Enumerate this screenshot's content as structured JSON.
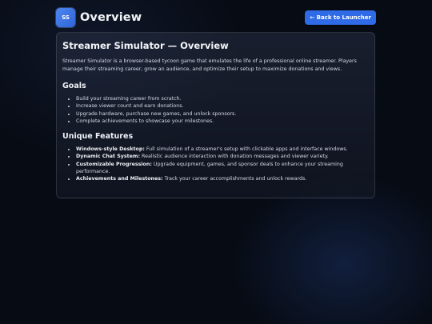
{
  "header": {
    "logo_text": "SS",
    "title": "Overview",
    "back_button_label": "← Back to Launcher"
  },
  "card": {
    "heading": "Streamer Simulator — Overview",
    "intro": "Streamer Simulator is a browser-based tycoon game that emulates the life of a professional online streamer. Players manage their streaming career, grow an audience, and optimize their setup to maximize donations and views.",
    "goals_heading": "Goals",
    "goals": [
      "Build your streaming career from scratch.",
      "Increase viewer count and earn donations.",
      "Upgrade hardware, purchase new games, and unlock sponsors.",
      "Complete achievements to showcase your milestones."
    ],
    "features_heading": "Unique Features",
    "features": [
      {
        "title": "Windows-style Desktop:",
        "text": "Full simulation of a streamer's setup with clickable apps and interface windows."
      },
      {
        "title": "Dynamic Chat System:",
        "text": "Realistic audience interaction with donation messages and viewer variety."
      },
      {
        "title": "Customizable Progression:",
        "text": "Upgrade equipment, games, and sponsor deals to enhance your streaming performance."
      },
      {
        "title": "Achievements and Milestones:",
        "text": "Track your career accomplishments and unlock rewards."
      }
    ]
  },
  "colors": {
    "background": "#070b14",
    "accent": "#2f6be6",
    "logo": "#3f78e8"
  }
}
